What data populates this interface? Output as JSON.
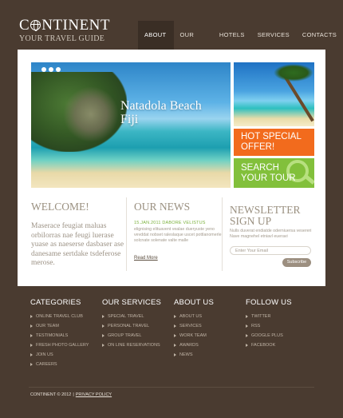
{
  "header": {
    "logo_title_part1": "C",
    "logo_title_part2": "NTINENT",
    "logo_subtitle": "YOUR TRAVEL GUIDE",
    "nav": [
      "ABOUT US",
      "OUR TOURS",
      "HOTELS",
      "SERVICES",
      "CONTACTS"
    ],
    "active_nav": "ABOUT US"
  },
  "slider": {
    "caption_line1": "Natadola Beach",
    "caption_line2": "Fiji"
  },
  "promos": {
    "orange_line1": "HOT SPECIAL",
    "orange_line2": "OFFER!",
    "green_line1": "SEARCH",
    "green_line2": "YOUR TOUR"
  },
  "welcome": {
    "title": "WELCOME!",
    "text": "Maserace feugiat maluas orbilorras nae feugi luerase yuase as naeserse dasbaser ase danesame sertdake tsdeferose merose."
  },
  "news": {
    "title": "OUR NEWS",
    "date": "15.JAN.2011 DABORE VELISTUS",
    "text": "elignising elituavent vealae dueryuste yeno vevddat nobset raleslaque uscet pottlanomerle solcnate solenate valte malle",
    "read_more": "Read More"
  },
  "newsletter": {
    "title_line1": "NEWSLETTER",
    "title_line2": "SIGN UP",
    "text": "Nulls duverat endiatde oderniuersa vesereri Nave magnehel etniavl eueravi",
    "input_placeholder": "Enter Your Email",
    "subscribe_label": "Subscribe"
  },
  "footer": {
    "categories": {
      "title": "CATEGORIES",
      "items": [
        "ONLINE TRAVEL CLUB",
        "OUR TEAM",
        "TESTIMONIALS",
        "FRESH PHOTO GALLERY",
        "JOIN US",
        "CAREERS"
      ]
    },
    "services": {
      "title": "OUR SERVICES",
      "items": [
        "SPECIAL TRAVEL",
        "PERSONAL TRAVEL",
        "GROUP TRAVEL",
        "ON LINE RESERVATIONS"
      ]
    },
    "about": {
      "title": "ABOUT US",
      "items": [
        "ABOUT US",
        "SERVICES",
        "WORK TEAM",
        "AWARDS",
        "NEWS"
      ]
    },
    "follow": {
      "title": "FOLLOW US",
      "items": [
        "TWITTER",
        "RSS",
        "GOOGLE PLUS",
        "FACEBOOK"
      ]
    },
    "copyright": "CONTINENT © 2012",
    "separator": "|",
    "privacy": "PRIVACY POLICY"
  },
  "colors": {
    "background": "#4a3b30",
    "nav_active": "#3a2e25",
    "orange": "#f26b1d",
    "green": "#82c03b",
    "news_date": "#7bb13c"
  }
}
